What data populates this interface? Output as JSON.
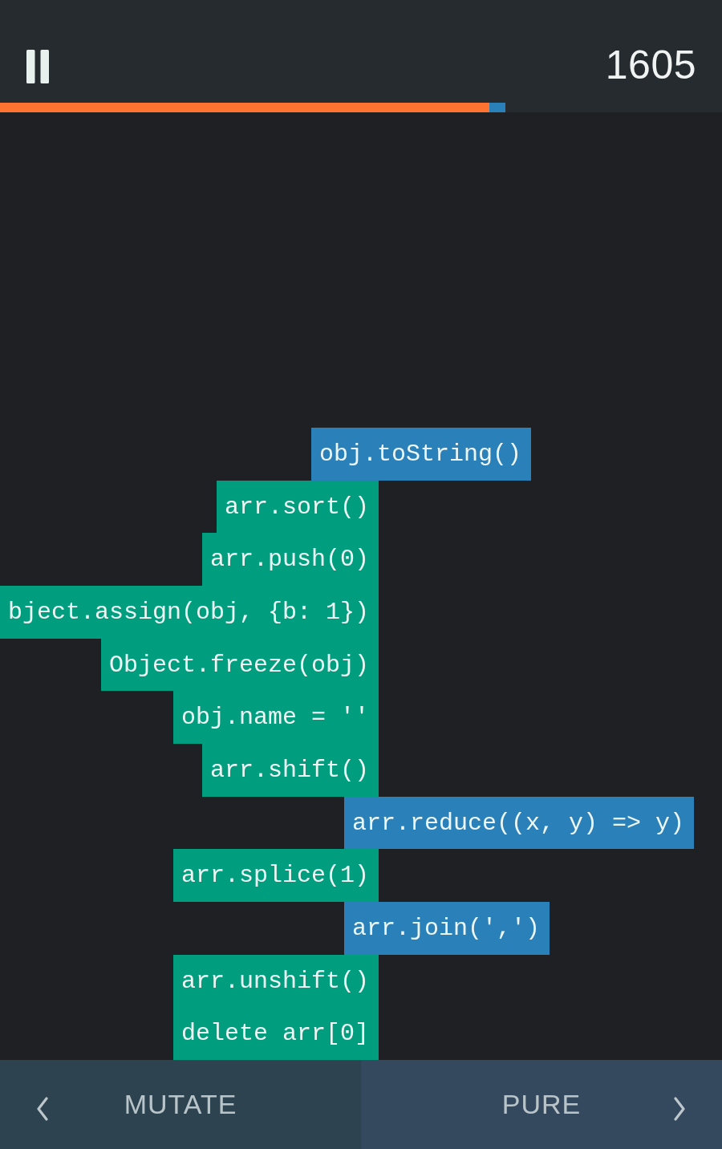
{
  "header": {
    "score": "1605",
    "progress": {
      "level": 0.7
    }
  },
  "falling_block": {
    "code": "obj.toString()",
    "kind": "pure"
  },
  "stack": [
    {
      "code": "arr.sort()",
      "kind": "mutate"
    },
    {
      "code": "arr.push(0)",
      "kind": "mutate"
    },
    {
      "code": "bject.assign(obj, {b: 1})",
      "kind": "mutate"
    },
    {
      "code": "Object.freeze(obj)",
      "kind": "mutate"
    },
    {
      "code": "obj.name = ''",
      "kind": "mutate"
    },
    {
      "code": "arr.shift()",
      "kind": "mutate"
    },
    {
      "code": "arr.reduce((x, y) => y)",
      "kind": "pure"
    },
    {
      "code": "arr.splice(1)",
      "kind": "mutate"
    },
    {
      "code": "arr.join(',')",
      "kind": "pure"
    },
    {
      "code": "arr.unshift()",
      "kind": "mutate"
    },
    {
      "code": "delete arr[0]",
      "kind": "mutate"
    }
  ],
  "buttons": [
    {
      "label": "MUTATE",
      "kind": "left"
    },
    {
      "label": "PURE",
      "kind": "right"
    }
  ]
}
